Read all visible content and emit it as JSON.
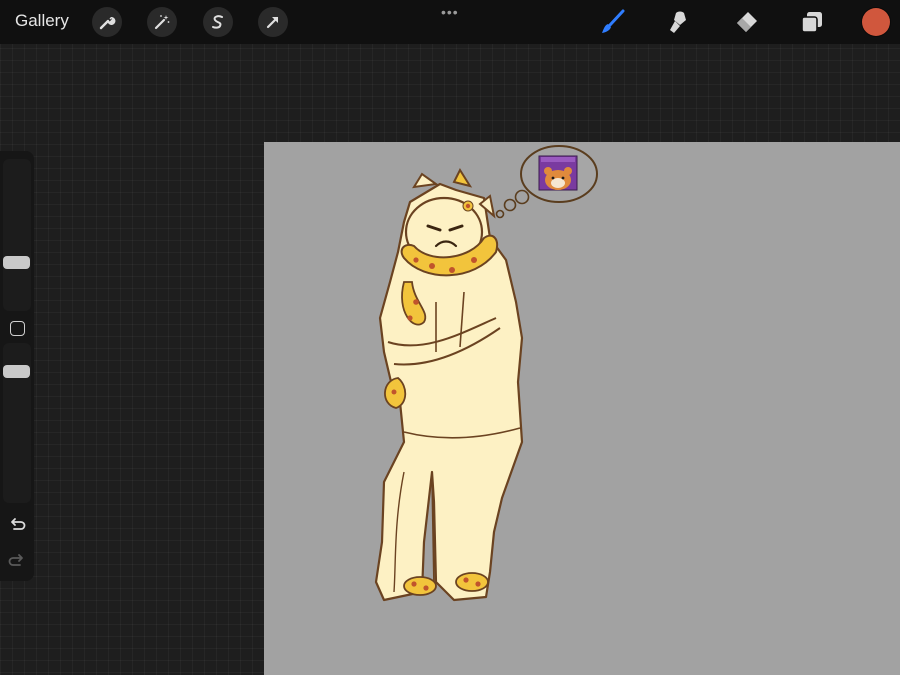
{
  "topbar": {
    "gallery_label": "Gallery",
    "left_tools": [
      "wrench-icon",
      "magic-wand-icon",
      "selection-icon",
      "transform-arrow-icon"
    ],
    "more_label": "•••",
    "right_tools": [
      "brush-icon",
      "smudge-icon",
      "eraser-icon",
      "layers-icon"
    ],
    "active_tool": "brush-icon",
    "active_color": "#d0573d",
    "accent_color": "#2f7dff"
  },
  "sidebar": {
    "size_slider_value": 0.3,
    "opacity_slider_value": 0.85,
    "controls": [
      "undo-icon",
      "redo-icon"
    ]
  },
  "canvas": {
    "background_color": "#a2a2a2",
    "content": "character-sketch"
  }
}
